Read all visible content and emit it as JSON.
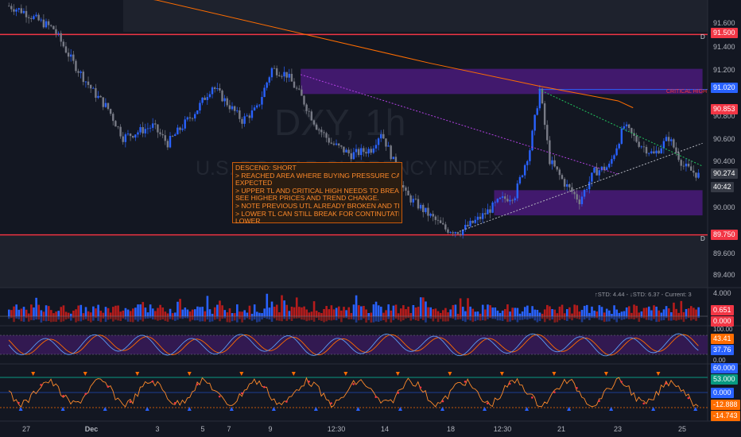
{
  "watermark": {
    "symbol": "DXY, 1h",
    "name": "U.S. DOLLAR CURRENCY INDEX"
  },
  "annotation": {
    "lines": [
      "DESCEND: SHORT",
      "> REACHED AREA WHERE BUYING PRESSURE CAN BE",
      "EXPECTED",
      "> UPPER TL AND CRITICAL HIGH NEEDS TO BREAK TO",
      "SEE HIGHER PRICES AND TREND CHANGE.",
      "> NOTE PREVIOUS UTL ALREADY BROKEN AND TESTED",
      "> LOWER TL CAN STILL BREAK FOR CONTINUTATION",
      "LOWER"
    ]
  },
  "critical_high_label": "CRITICAL HIGH",
  "level_markers": {
    "upper": "D",
    "lower": "D"
  },
  "price_axis": {
    "ticks": [
      "91.600",
      "91.400",
      "91.200",
      "90.800",
      "90.600",
      "90.400",
      "90.000",
      "89.600",
      "89.400"
    ],
    "tags": {
      "resistance": "91.500",
      "critical_high": "91.020",
      "ma": "90.853",
      "last": "90.274",
      "countdown": "40:42",
      "support": "89.750"
    }
  },
  "pane1": {
    "info": "↑STD: 4.44 - ↓STD: 6.37 - Current: 3",
    "ticks": [
      "4.000"
    ],
    "tags": {
      "value": "0.651",
      "zero": "0.000"
    }
  },
  "pane2": {
    "ticks": [
      "100.00",
      "0.00"
    ],
    "tags": {
      "upper": "43.41",
      "lower": "37.76"
    }
  },
  "pane3": {
    "tags": {
      "top": "60.000",
      "mid": "53.000",
      "zero": "0.000",
      "neg": "-12.888",
      "low": "-14.743"
    }
  },
  "time_axis": {
    "labels": [
      "27",
      "Dec",
      "3",
      "5",
      "7",
      "9",
      "12:30",
      "14",
      "18",
      "12:30",
      "21",
      "23",
      "25"
    ]
  },
  "colors": {
    "background": "#131722",
    "up": "#2962ff",
    "down": "#787b86",
    "resistance": "#f23645",
    "critical": "#2962ff",
    "ma": "#ff6d00",
    "zone": "#4a1a7a",
    "accent": "#ff8a2a"
  },
  "chart_data": {
    "type": "candlestick",
    "symbol": "DXY",
    "timeframe": "1h",
    "levels": {
      "resistance": 91.5,
      "critical_high": 91.02,
      "ma": 90.853,
      "last": 90.274,
      "support": 89.75
    },
    "y_range": [
      89.3,
      91.7
    ],
    "path": [
      [
        0,
        91.75
      ],
      [
        6,
        91.7
      ],
      [
        12,
        91.62
      ],
      [
        18,
        91.55
      ],
      [
        26,
        91.25
      ],
      [
        34,
        91.0
      ],
      [
        40,
        90.85
      ],
      [
        46,
        90.6
      ],
      [
        52,
        90.65
      ],
      [
        58,
        90.7
      ],
      [
        64,
        90.55
      ],
      [
        70,
        90.7
      ],
      [
        76,
        90.85
      ],
      [
        82,
        91.05
      ],
      [
        88,
        90.9
      ],
      [
        94,
        90.75
      ],
      [
        100,
        90.85
      ],
      [
        106,
        91.2
      ],
      [
        112,
        91.15
      ],
      [
        118,
        90.95
      ],
      [
        124,
        90.7
      ],
      [
        130,
        90.55
      ],
      [
        138,
        90.45
      ],
      [
        146,
        90.5
      ],
      [
        150,
        90.65
      ],
      [
        154,
        90.45
      ],
      [
        160,
        90.1
      ],
      [
        168,
        89.95
      ],
      [
        176,
        89.8
      ],
      [
        182,
        89.78
      ],
      [
        190,
        89.9
      ],
      [
        198,
        90.05
      ],
      [
        204,
        90.1
      ],
      [
        210,
        90.5
      ],
      [
        214,
        91.02
      ],
      [
        218,
        90.4
      ],
      [
        224,
        90.2
      ],
      [
        230,
        90.05
      ],
      [
        236,
        90.3
      ],
      [
        242,
        90.35
      ],
      [
        248,
        90.7
      ],
      [
        254,
        90.55
      ],
      [
        260,
        90.45
      ],
      [
        266,
        90.6
      ],
      [
        272,
        90.35
      ],
      [
        278,
        90.27
      ]
    ],
    "zones": [
      {
        "from_bar": 118,
        "to_bar": 280,
        "low": 90.98,
        "high": 91.2
      },
      {
        "from_bar": 196,
        "to_bar": 280,
        "low": 89.92,
        "high": 90.14
      }
    ],
    "trendlines": [
      {
        "name": "upper-descending",
        "from": [
          118,
          91.15
        ],
        "to": [
          246,
          90.28
        ]
      },
      {
        "name": "lower-ascending",
        "from": [
          182,
          89.78
        ],
        "to": [
          280,
          90.55
        ]
      },
      {
        "name": "critical-descending",
        "from": [
          214,
          91.02
        ],
        "to": [
          280,
          90.35
        ]
      }
    ],
    "ma_path": [
      [
        0,
        92.0
      ],
      [
        60,
        91.8
      ],
      [
        120,
        91.5
      ],
      [
        170,
        91.25
      ],
      [
        214,
        91.05
      ],
      [
        246,
        90.92
      ],
      [
        252,
        90.86
      ]
    ]
  }
}
